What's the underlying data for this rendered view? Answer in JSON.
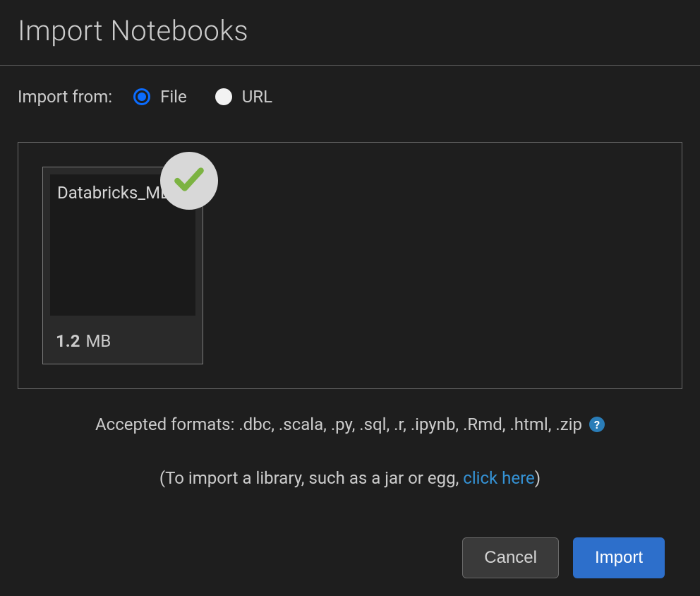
{
  "dialog": {
    "title": "Import Notebooks"
  },
  "importFrom": {
    "label": "Import from:",
    "options": {
      "file": "File",
      "url": "URL"
    },
    "selected": "file"
  },
  "file": {
    "name": "Databricks_ML",
    "sizeValue": "1.2",
    "sizeUnit": "MB"
  },
  "hints": {
    "formats": "Accepted formats: .dbc, .scala, .py, .sql, .r, .ipynb, .Rmd, .html, .zip",
    "libraryPrefix": "(To import a library, such as a jar or egg, ",
    "libraryLink": "click here",
    "librarySuffix": ")"
  },
  "buttons": {
    "cancel": "Cancel",
    "import": "Import"
  }
}
